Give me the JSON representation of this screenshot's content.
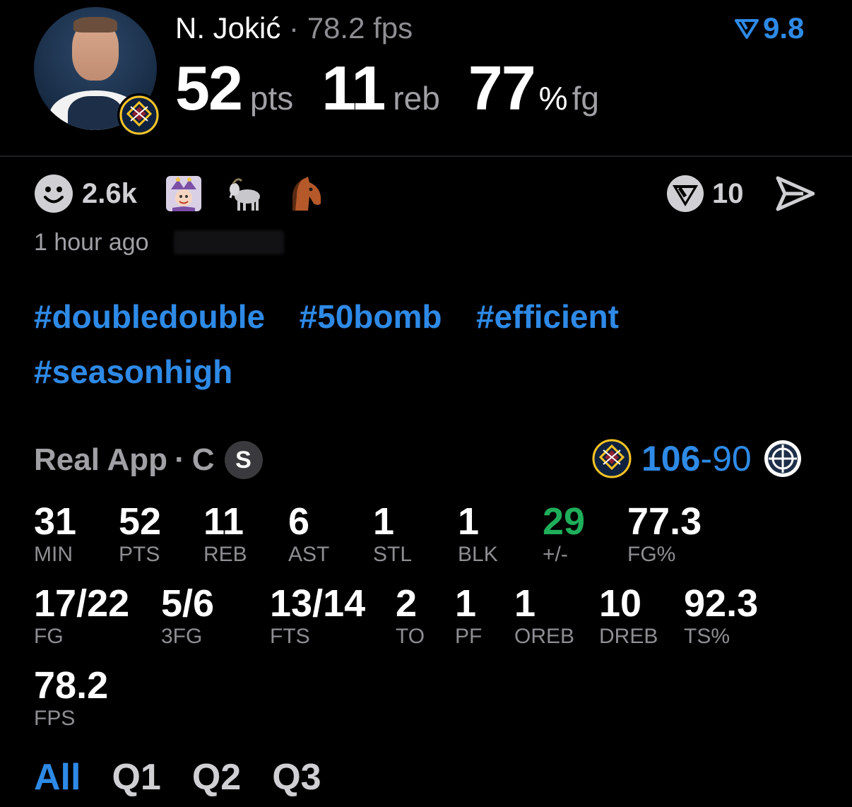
{
  "header": {
    "player_name": "N. Jokić",
    "separator": "·",
    "fps_text": "78.2 fps",
    "rating_value": "9.8",
    "points": "52",
    "points_unit": "pts",
    "rebounds": "11",
    "rebounds_unit": "reb",
    "fg_pct": "77",
    "fg_pct_unit": "%",
    "fg_unit": "fg"
  },
  "reactions": {
    "count": "2.6k",
    "emojis": [
      "jester-emoji",
      "goat-emoji",
      "horse-emoji"
    ],
    "comments_count": "10"
  },
  "time_ago": "1 hour ago",
  "hashtags": [
    "#doubledouble",
    "#50bomb",
    "#efficient",
    "#seasonhigh"
  ],
  "game": {
    "source": "Real App",
    "separator": "·",
    "position": "C",
    "badge": "S",
    "home_score": "106",
    "score_dash": "-",
    "away_score": "90"
  },
  "stats": [
    {
      "value": "31",
      "label": "MIN"
    },
    {
      "value": "52",
      "label": "PTS"
    },
    {
      "value": "11",
      "label": "REB"
    },
    {
      "value": "6",
      "label": "AST"
    },
    {
      "value": "1",
      "label": "STL"
    },
    {
      "value": "1",
      "label": "BLK"
    },
    {
      "value": "29",
      "label": "+/-"
    },
    {
      "value": "77.3",
      "label": "FG%"
    },
    {
      "value": "17/22",
      "label": "FG"
    },
    {
      "value": "5/6",
      "label": "3FG"
    },
    {
      "value": "13/14",
      "label": "FTS"
    },
    {
      "value": "2",
      "label": "TO"
    },
    {
      "value": "1",
      "label": "PF"
    },
    {
      "value": "1",
      "label": "OREB"
    },
    {
      "value": "10",
      "label": "DREB"
    },
    {
      "value": "92.3",
      "label": "TS%"
    },
    {
      "value": "78.2",
      "label": "FPS"
    }
  ],
  "colors": {
    "accent": "#2e8ae6",
    "positive": "#1fae5a",
    "background": "#000000"
  },
  "tabs": [
    "All",
    "Q1",
    "Q2",
    "Q3"
  ]
}
